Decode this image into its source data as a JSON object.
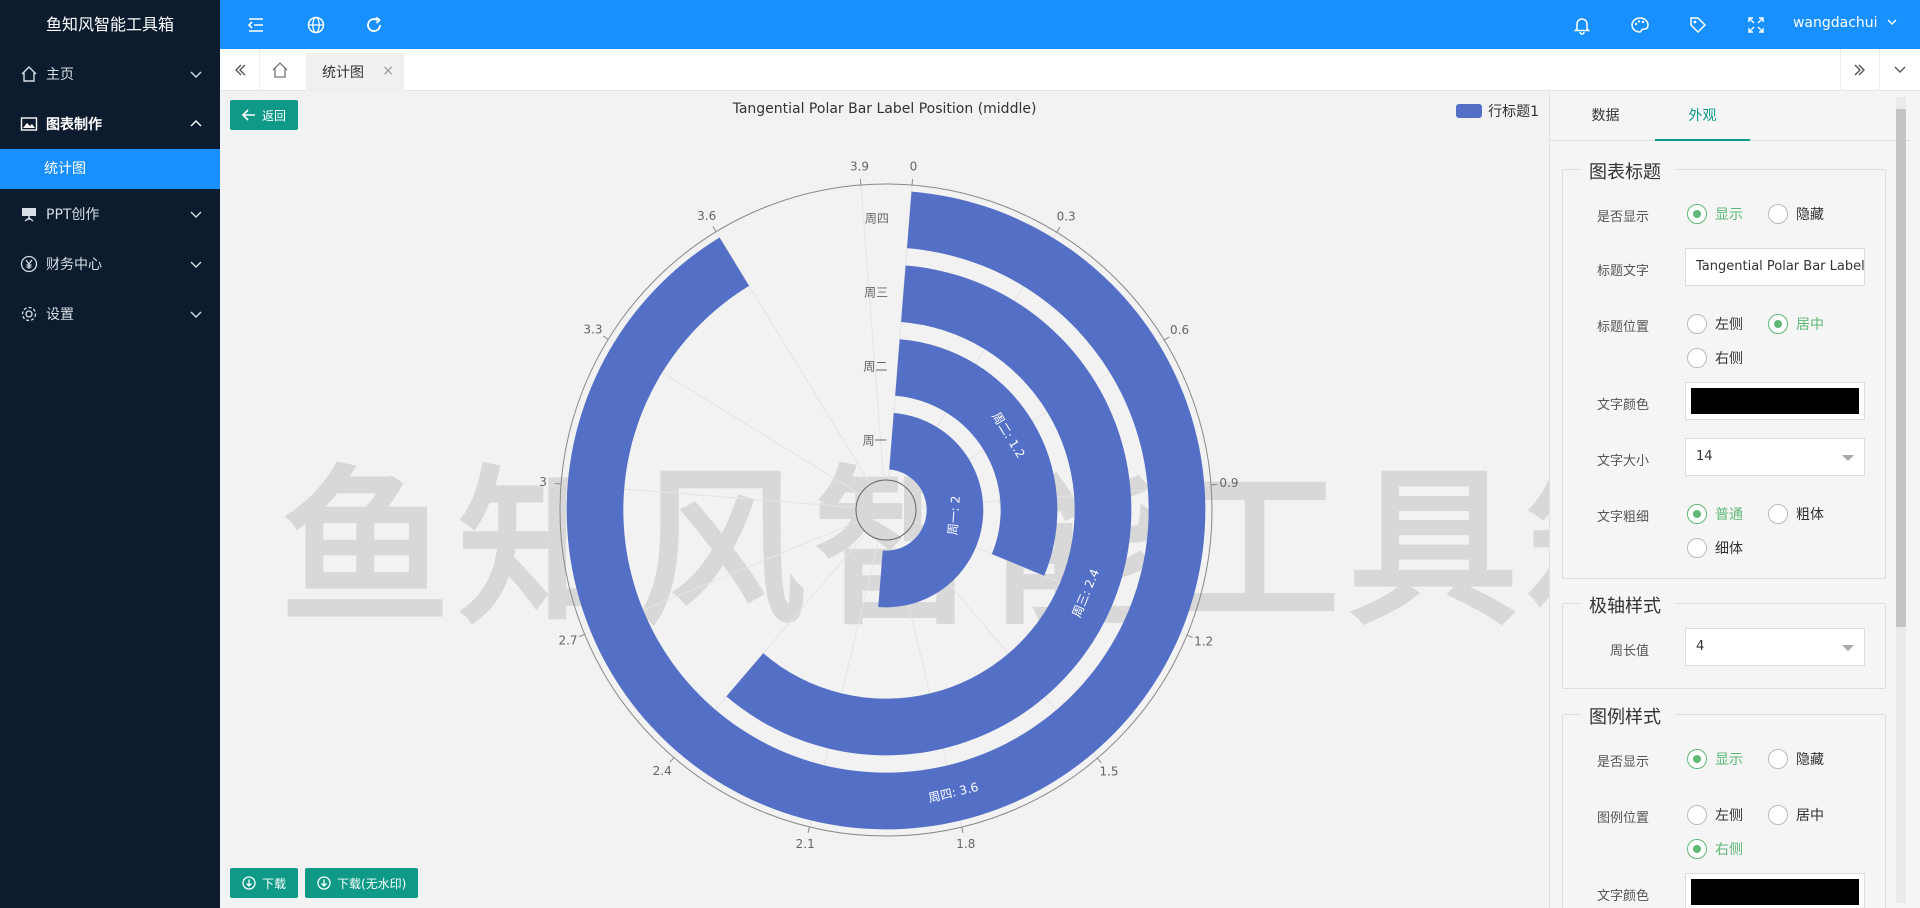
{
  "app": {
    "title": "鱼知风智能工具箱",
    "user": "wangdachui"
  },
  "sidebar": {
    "items": [
      {
        "label": "主页",
        "icon": "home-icon"
      },
      {
        "label": "图表制作",
        "icon": "image-icon"
      },
      {
        "label": "PPT创作",
        "icon": "presentation-icon"
      },
      {
        "label": "财务中心",
        "icon": "yen-icon"
      },
      {
        "label": "设置",
        "icon": "gear-icon"
      }
    ],
    "sub_item": "统计图"
  },
  "tabs": {
    "active": "统计图",
    "close": "×"
  },
  "content": {
    "back_label": "返回",
    "download_label": "下载",
    "download_nowm_label": "下载(无水印)",
    "watermark": "鱼知风智能工具箱"
  },
  "chart_data": {
    "type": "bar",
    "polar": true,
    "title": "Tangential Polar Bar Label Position (middle)",
    "categories": [
      "周一",
      "周二",
      "周三",
      "周四"
    ],
    "series": [
      {
        "name": "行标题1",
        "values": [
          2,
          1.2,
          2.4,
          3.6
        ]
      }
    ],
    "data_labels": [
      "周一: 2",
      "周二: 1.2",
      "周三: 2.4",
      "周四: 3.6"
    ],
    "angle_axis": {
      "max": 4,
      "ticks": [
        "0",
        "0.3",
        "0.6",
        "0.9",
        "1.2",
        "1.5",
        "1.8",
        "2.1",
        "2.4",
        "2.7",
        "3",
        "3.3",
        "3.6",
        "3.9"
      ]
    },
    "legend": "top-right",
    "color": "#5470c6"
  },
  "panel": {
    "tabs": [
      "数据",
      "外观"
    ],
    "active_tab": "外观",
    "title_section": {
      "heading": "图表标题",
      "show_label": "是否显示",
      "show_on": "显示",
      "show_off": "隐藏",
      "text_label": "标题文字",
      "text_value": "Tangential Polar Bar Label",
      "pos_label": "标题位置",
      "pos_left": "左侧",
      "pos_center": "居中",
      "pos_right": "右侧",
      "color_label": "文字颜色",
      "color_value": "#000000",
      "size_label": "文字大小",
      "size_value": "14",
      "weight_label": "文字粗细",
      "weight_normal": "普通",
      "weight_bold": "粗体",
      "weight_light": "细体"
    },
    "polar_section": {
      "heading": "极轴样式",
      "circ_label": "周长值",
      "circ_value": "4"
    },
    "legend_section": {
      "heading": "图例样式",
      "show_label": "是否显示",
      "show_on": "显示",
      "show_off": "隐藏",
      "pos_label": "图例位置",
      "pos_left": "左侧",
      "pos_center": "居中",
      "pos_right": "右侧",
      "color_label": "文字颜色"
    }
  }
}
